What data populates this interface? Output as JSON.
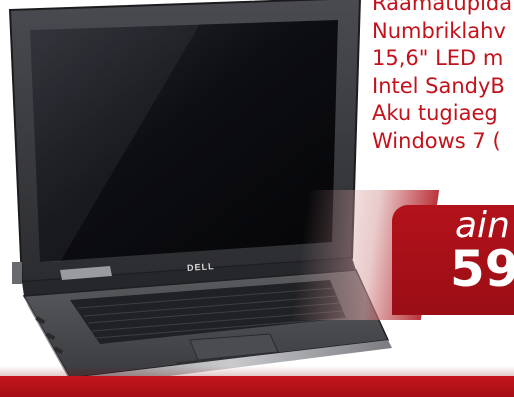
{
  "specs": {
    "lines": [
      "Raamatupida",
      "Numbriklahv",
      "15,6\" LED m",
      "Intel SandyB",
      "Aku tugiaeg",
      "Windows 7 ("
    ]
  },
  "price": {
    "label": "ain",
    "value": "59"
  },
  "laptop": {
    "brand": "DELL"
  },
  "colors": {
    "accent_red": "#c3121b",
    "laptop_body": "#3a3a3c",
    "screen": "#141418"
  }
}
